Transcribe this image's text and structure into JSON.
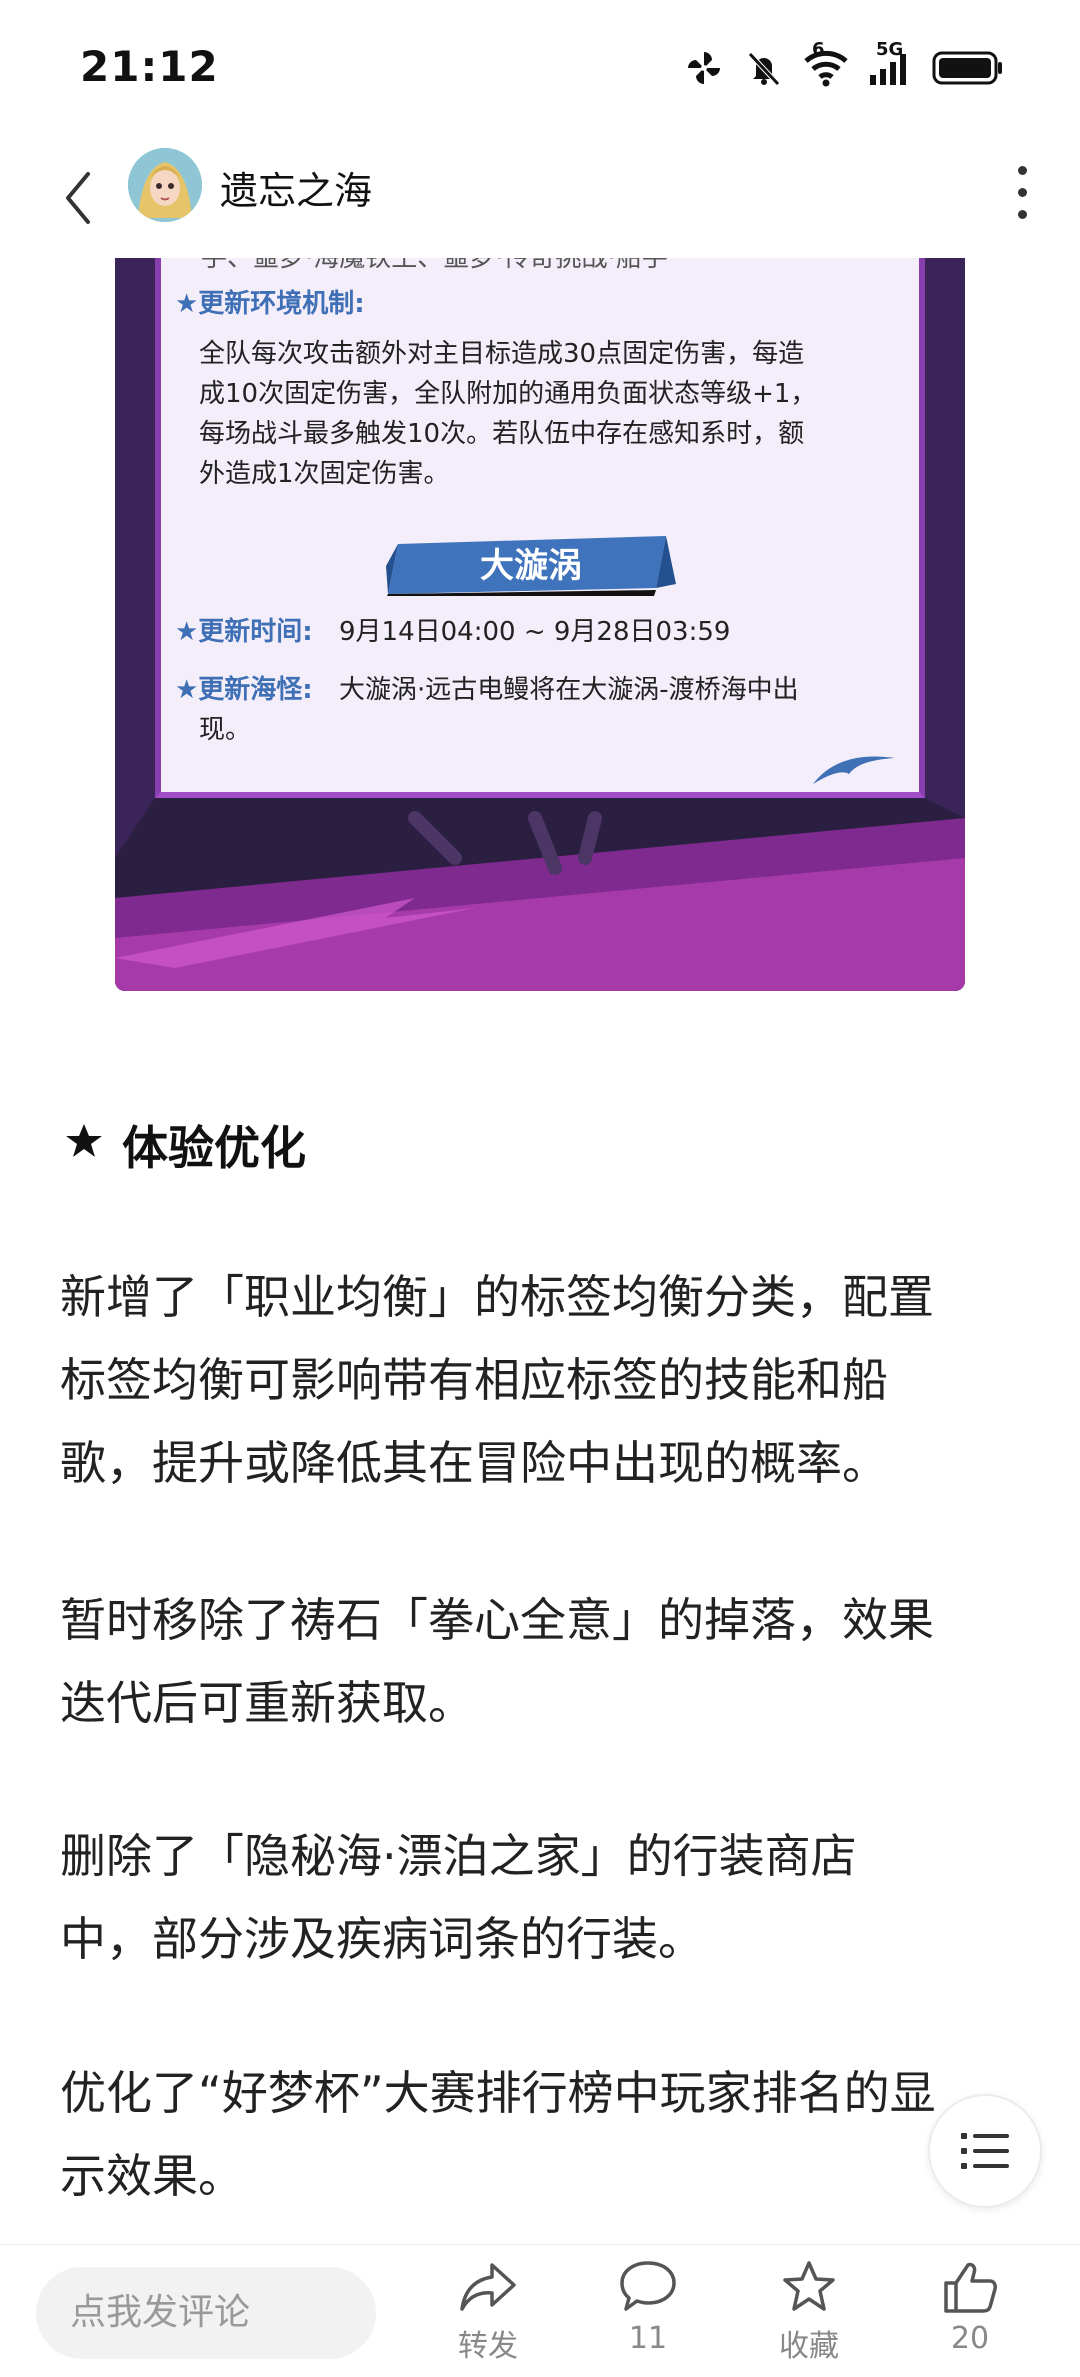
{
  "status_bar": {
    "time": "21:12",
    "network": "5G",
    "wifi_badge": "6",
    "icons": [
      "pinwheel-icon",
      "mute-bell-icon",
      "wifi-icon",
      "signal-icon",
      "battery-icon"
    ]
  },
  "header": {
    "title": "遗忘之海"
  },
  "article_image": {
    "top_cut_line": "手、噩梦·海魔铁王、噩梦·传奇挑战·船手",
    "env_label": "★更新环境机制:",
    "env_text_lines": [
      "全队每次攻击额外对主目标造成30点固定伤害，每造",
      "成10次固定伤害，全队附加的通用负面状态等级+1，",
      "每场战斗最多触发10次。若队伍中存在感知系时，额",
      "外造成1次固定伤害。"
    ],
    "banner": "大漩涡",
    "time_label": "★更新时间:",
    "time_value": "9月14日04:00 ~ 9月28日03:59",
    "monster_label": "★更新海怪:",
    "monster_text_lines": [
      "大漩涡·远古电鳗将在大漩涡-渡桥海中出",
      "现。"
    ]
  },
  "article": {
    "section_heading": "体验优化",
    "paragraphs": [
      [
        "新增了「职业均衡」的标签均衡分类，配置",
        "标签均衡可影响带有相应标签的技能和船",
        "歌，提升或降低其在冒险中出现的概率。"
      ],
      [
        "暂时移除了祷石「拳心全意」的掉落，效果",
        "迭代后可重新获取。"
      ],
      [
        "删除了「隐秘海·漂泊之家」的行装商店",
        "中，部分涉及疾病词条的行装。"
      ],
      [
        "优化了“好梦杯”大赛排行榜中玩家排名的显",
        "示效果。"
      ]
    ]
  },
  "bottom_bar": {
    "comment_placeholder": "点我发评论",
    "share_label": "转发",
    "comment_count": "11",
    "favorite_label": "收藏",
    "like_count": "20"
  },
  "colors": {
    "accent_blue": "#3f6fb5",
    "panel_purple": "#8a3fb0",
    "dark_bg": "#2a1f3f"
  }
}
